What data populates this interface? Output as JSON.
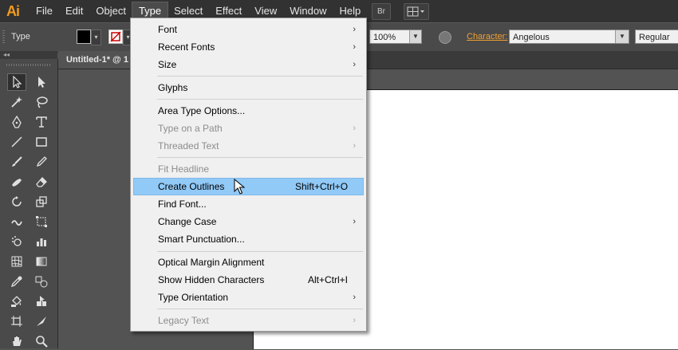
{
  "app": {
    "logo": "Ai"
  },
  "menubar": {
    "items": [
      "File",
      "Edit",
      "Object",
      "Type",
      "Select",
      "Effect",
      "View",
      "Window",
      "Help"
    ],
    "active": "Type",
    "bridge_label": "Br"
  },
  "controlbar": {
    "tool_label": "Type",
    "opacity": "100%",
    "character_label": "Character:",
    "font_family": "Angelous",
    "font_style": "Regular"
  },
  "document": {
    "tab_title": "Untitled-1* @ 1"
  },
  "type_menu": {
    "items": [
      {
        "label": "Font",
        "submenu": true,
        "enabled": true
      },
      {
        "label": "Recent Fonts",
        "submenu": true,
        "enabled": true
      },
      {
        "label": "Size",
        "submenu": true,
        "enabled": true
      },
      {
        "label": "Glyphs",
        "enabled": true
      },
      {
        "label": "Area Type Options...",
        "enabled": true
      },
      {
        "label": "Type on a Path",
        "submenu": true,
        "enabled": false
      },
      {
        "label": "Threaded Text",
        "submenu": true,
        "enabled": false
      },
      {
        "label": "Fit Headline",
        "enabled": false
      },
      {
        "label": "Create Outlines",
        "shortcut": "Shift+Ctrl+O",
        "enabled": true,
        "highlighted": true
      },
      {
        "label": "Find Font...",
        "enabled": true
      },
      {
        "label": "Change Case",
        "submenu": true,
        "enabled": true
      },
      {
        "label": "Smart Punctuation...",
        "enabled": true
      },
      {
        "label": "Optical Margin Alignment",
        "enabled": true
      },
      {
        "label": "Show Hidden Characters",
        "shortcut": "Alt+Ctrl+I",
        "enabled": true
      },
      {
        "label": "Type Orientation",
        "submenu": true,
        "enabled": true
      },
      {
        "label": "Legacy Text",
        "submenu": true,
        "enabled": false
      }
    ]
  },
  "icons": {
    "tools": [
      "selection-tool",
      "direct-selection-tool",
      "magic-wand-tool",
      "lasso-tool",
      "pen-tool",
      "type-tool",
      "line-segment-tool",
      "rectangle-tool",
      "paintbrush-tool",
      "pencil-tool",
      "blob-brush-tool",
      "eraser-tool",
      "rotate-tool",
      "scale-tool",
      "warp-tool",
      "free-transform-tool",
      "symbol-sprayer-tool",
      "column-graph-tool",
      "mesh-tool",
      "gradient-tool",
      "eyedropper-tool",
      "blend-tool",
      "live-paint-bucket-tool",
      "live-paint-selection-tool",
      "artboard-tool",
      "slice-tool",
      "hand-tool",
      "zoom-tool"
    ],
    "submenu_arrow": "›"
  },
  "colors": {
    "menubar_bg": "#323232",
    "panel_bg": "#4a4a4a",
    "menu_bg": "#f0f0f0",
    "highlight": "#91c9f7",
    "ai_orange": "#f29b1d",
    "character_label": "#f0a030"
  }
}
